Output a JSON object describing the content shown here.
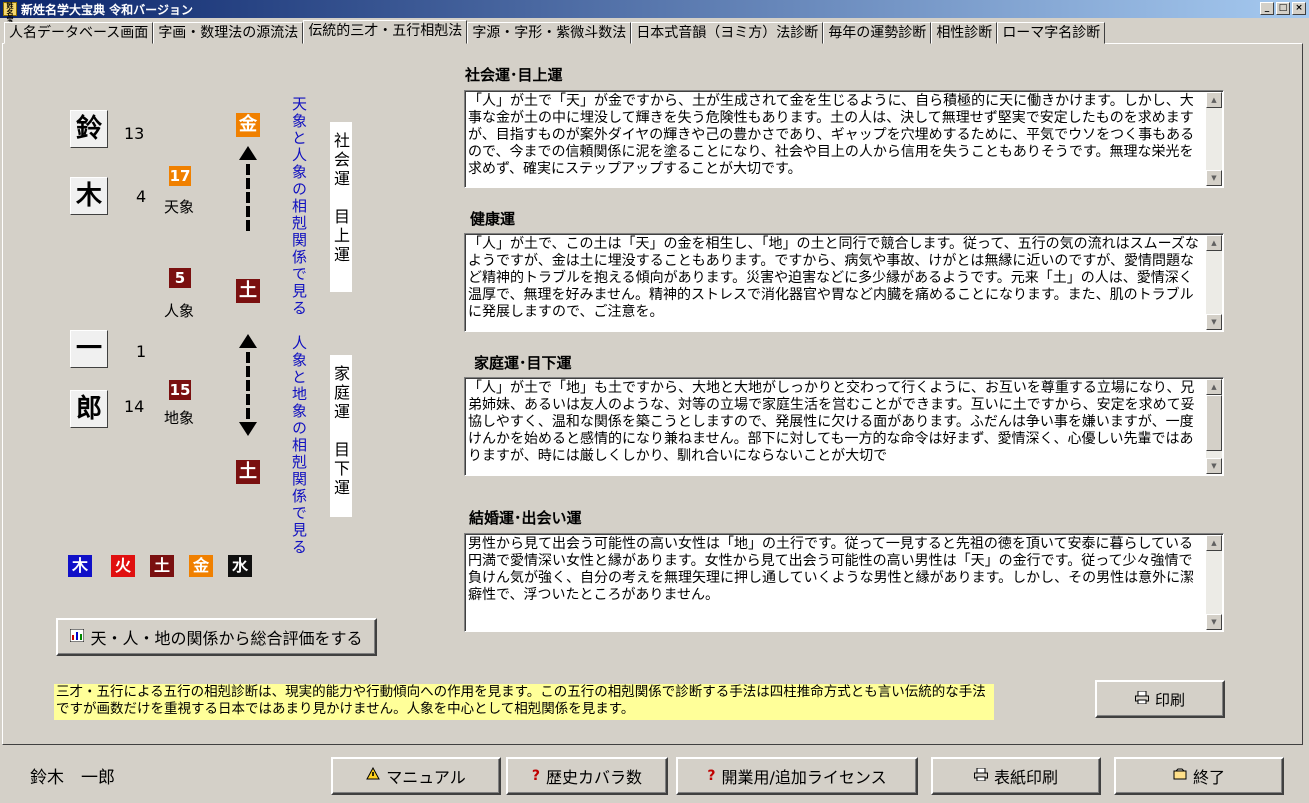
{
  "window": {
    "icon_text": "姓名宝典",
    "title": "新姓名学大宝典 令和バージョン",
    "buttons": [
      "_",
      "□",
      "×"
    ]
  },
  "tabs": [
    {
      "label": "人名データベース画面",
      "active": false
    },
    {
      "label": "字画・数理法の源流法",
      "active": false
    },
    {
      "label": "伝統的三才・五行相剋法",
      "active": true
    },
    {
      "label": "字源・字形・紫微斗数法",
      "active": false
    },
    {
      "label": "日本式音韻（ヨミ方）法診断",
      "active": false
    },
    {
      "label": "毎年の運勢診断",
      "active": false
    },
    {
      "label": "相性診断",
      "active": false
    },
    {
      "label": "ローマ字名診断",
      "active": false
    }
  ],
  "name_chars": [
    {
      "char": "鈴",
      "strokes": "13"
    },
    {
      "char": "木",
      "strokes": "4"
    },
    {
      "char": "一",
      "strokes": "1"
    },
    {
      "char": "郎",
      "strokes": "14"
    }
  ],
  "kaku": {
    "ten": {
      "value": "17",
      "label": "天象",
      "color": "#f08000"
    },
    "jin": {
      "value": "5",
      "label": "人象",
      "color": "#7a1010"
    },
    "chi": {
      "value": "15",
      "label": "地象",
      "color": "#7a1010"
    }
  },
  "elements_column": {
    "top": {
      "char": "金",
      "color": "#f08000"
    },
    "middle": {
      "char": "土",
      "color": "#7a1010"
    },
    "bottom": {
      "char": "土",
      "color": "#7a1010"
    }
  },
  "vertical_notes": {
    "upper": "天象と人象の相剋関係で見る",
    "lower": "人象と地象の相剋関係で見る",
    "box_upper": "社会運　目上運",
    "box_lower": "家庭運　目下運"
  },
  "legend": [
    {
      "char": "木",
      "color": "#1010c8"
    },
    {
      "char": "火",
      "color": "#e01010"
    },
    {
      "char": "土",
      "color": "#7a1010"
    },
    {
      "char": "金",
      "color": "#f08000"
    },
    {
      "char": "水",
      "color": "#101010"
    }
  ],
  "eval_button": "天・人・地の関係から総合評価をする",
  "sections": [
    {
      "title": "社会運･目上運",
      "text": "「人」が土で「天」が金ですから、土が生成されて金を生じるように、自ら積極的に天に働きかけます。しかし、大事な金が土の中に埋没して輝きを失う危険性もあります。土の人は、決して無理せず堅実で安定したものを求めますが、目指すものが案外ダイヤの輝きや己の豊かさであり、ギャップを穴埋めするために、平気でウソをつく事もあるので、今までの信頼関係に泥を塗ることになり、社会や目上の人から信用を失うこともありそうです。無理な栄光を求めず、確実にステップアップすることが大切です。"
    },
    {
      "title": "健康運",
      "text": "「人」が土で、この土は「天」の金を相生し、「地」の土と同行で競合します。従って、五行の気の流れはスムーズなようですが、金は土に埋没することもあります。ですから、病気や事故、けがとは無縁に近いのですが、愛情問題など精神的トラブルを抱える傾向があります。災害や迫害などに多少縁があるようです。元来「土」の人は、愛情深く温厚で、無理を好みません。精神的ストレスで消化器官や胃など内臓を痛めることになります。また、肌のトラブルに発展しますので、ご注意を。"
    },
    {
      "title": "家庭運･目下運",
      "text": "「人」が土で「地」も土ですから、大地と大地がしっかりと交わって行くように、お互いを尊重する立場になり、兄弟姉妹、あるいは友人のような、対等の立場で家庭生活を営むことができます。互いに土ですから、安定を求めて妥協しやすく、温和な関係を築こうとしますので、発展性に欠ける面があります。ふだんは争い事を嫌いますが、一度けんかを始めると感情的になり兼ねません。部下に対しても一方的な命令は好まず、愛情深く、心優しい先輩ではありますが、時には厳しくしかり、馴れ合いにならないことが大切で"
    },
    {
      "title": "結婚運･出会い運",
      "text": "男性から見て出会う可能性の高い女性は「地」の土行です。従って一見すると先祖の徳を頂いて安泰に暮らしている円満で愛情深い女性と縁があります。女性から見て出会う可能性の高い男性は「天」の金行です。従って少々強情で負けん気が強く、自分の考えを無理矢理に押し通していくような男性と縁があります。しかし、その男性は意外に潔癖性で、浮ついたところがありません。"
    }
  ],
  "info_note": "三才・五行による五行の相剋診断は、現実的能力や行動傾向への作用を見ます。この五行の相剋関係で診断する手法は四柱推命方式とも言い伝統的な手法ですが画数だけを重視する日本ではあまり見かけません。人象を中心として相剋関係を見ます。",
  "print_button": "印刷",
  "status_name": "鈴木　一郎",
  "bottom_buttons": [
    {
      "label": "マニュアル",
      "icon": "manual-icon"
    },
    {
      "label": "歴史カバラ数",
      "icon": "help-icon"
    },
    {
      "label": "開業用/追加ライセンス",
      "icon": "help-icon"
    },
    {
      "label": "表紙印刷",
      "icon": "printer-icon"
    },
    {
      "label": "終了",
      "icon": "exit-icon"
    }
  ]
}
